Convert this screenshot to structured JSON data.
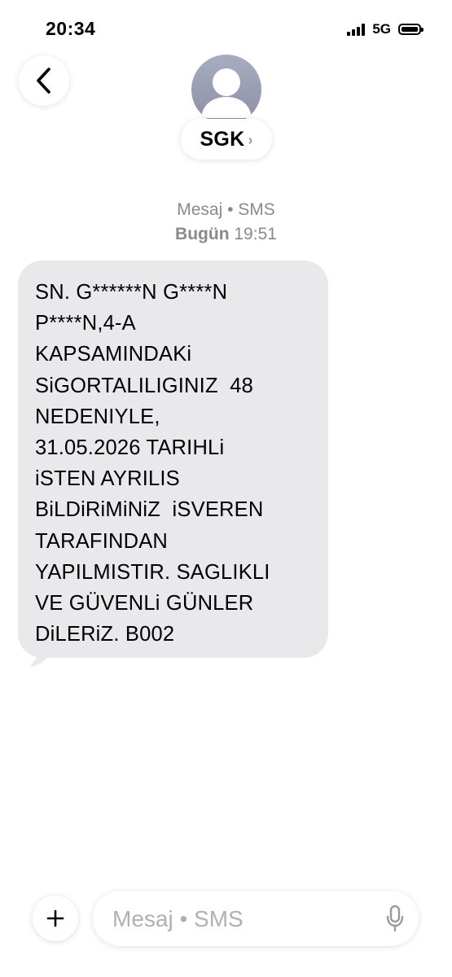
{
  "status_bar": {
    "time": "20:34",
    "network": "5G",
    "battery_level": 1.0
  },
  "header": {
    "back_icon": "chevron-left-icon",
    "avatar_icon": "person-icon",
    "contact_name": "SGK",
    "contact_chevron": "›"
  },
  "conversation": {
    "service_label": "Mesaj • SMS",
    "day_label": "Bugün",
    "time_label": "19:51",
    "message_lines": [
      "SN. G******N G****N",
      "P****N,4-A",
      "KAPSAMINDAKi",
      "SiGORTALILIGINIZ  48",
      "NEDENIYLE,",
      "31.05.2026 TARIHLi",
      "iSTEN AYRILIS",
      "BiLDiRiMiNiZ  iSVEREN",
      "TARAFINDAN",
      "YAPILMISTIR. SAGLIKLI",
      "VE GÜVENLi GÜNLER",
      "DiLERiZ. B002"
    ]
  },
  "composer": {
    "add_icon": "plus-icon",
    "placeholder": "Mesaj • SMS",
    "value": "",
    "mic_icon": "microphone-icon"
  },
  "colors": {
    "bubble": "#e9e9eb",
    "meta_text": "#8a8a8e",
    "placeholder": "#b0b0b5",
    "avatar": "#8b90a6"
  }
}
